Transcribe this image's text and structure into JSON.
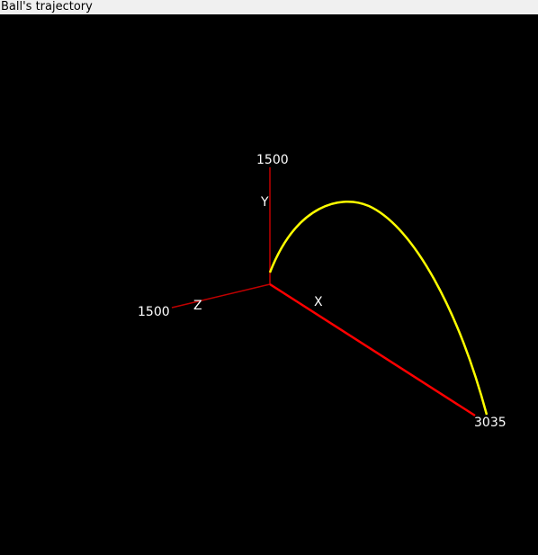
{
  "window": {
    "title": "Ball's trajectory"
  },
  "scene": {
    "background_color": "#000000",
    "x_axis_color": "#ff0000",
    "y_axis_color": "#c00000",
    "z_axis_color": "#c00000",
    "trajectory_color": "#ffff00",
    "label_color": "#ffffff",
    "axes": {
      "x": {
        "name": "X",
        "max_label": "3035"
      },
      "y": {
        "name": "Y",
        "max_label": "1500"
      },
      "z": {
        "name": "Z",
        "max_label": "1500"
      }
    }
  }
}
